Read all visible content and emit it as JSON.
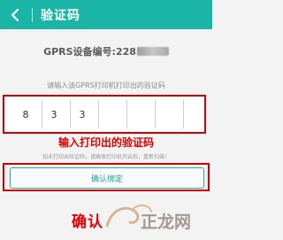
{
  "header": {
    "title": "验证码",
    "back_icon": "chevron-left-icon",
    "background": "#1bb5a8"
  },
  "device": {
    "label": "GPRS设备编号:",
    "number_visible": "228"
  },
  "code_entry": {
    "prompt": "请输入该GPRS打印机打印出的验证码",
    "digits": [
      "8",
      "3",
      "3",
      "",
      "",
      "",
      ""
    ]
  },
  "annotation": {
    "enter_code": "输入打印出的验证码",
    "confirm": "确认",
    "color": "#e00000"
  },
  "tip": "如未打印出验证码，请确保打印机开启后，重新扫描！",
  "confirm_button": {
    "label": "确认绑定"
  },
  "watermark": {
    "text": "正龙网",
    "icon": "dragon-logo-icon"
  }
}
